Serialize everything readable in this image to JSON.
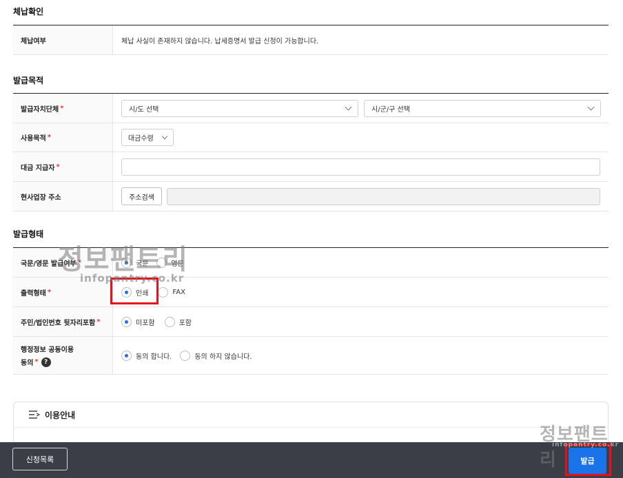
{
  "payment_check": {
    "title": "체납확인",
    "label": "체납여부",
    "value": "체납 사실이 존재하지 않습니다. 납세증명서 발급 신청이 가능합니다."
  },
  "purpose": {
    "title": "발급목적",
    "rows": {
      "authority": {
        "label": "발급자치단체",
        "sido_placeholder": "시/도 선택",
        "sigungu_placeholder": "시/군/구 선택"
      },
      "use": {
        "label": "사용목적",
        "value": "대금수령"
      },
      "payer": {
        "label": "대금 지급자"
      },
      "site_address": {
        "label": "현사업장 주소",
        "search_button": "주소검색"
      }
    }
  },
  "form": {
    "title": "발급형태",
    "language": {
      "label": "국문/영문 발급여부",
      "options": [
        "국문",
        "영문"
      ],
      "selected": 0
    },
    "output": {
      "label": "출력형태",
      "options": [
        "인쇄",
        "FAX"
      ],
      "selected": 0
    },
    "id_suffix": {
      "label": "주민/법인번호 뒷자리포함",
      "options": [
        "미포함",
        "포함"
      ],
      "selected": 0
    },
    "consent": {
      "label_line1": "행정정보 공동이용",
      "label_line2": "동의",
      "help": "?",
      "options": [
        "동의 합니다.",
        "동의 하지 않습니다."
      ],
      "selected": 0
    }
  },
  "guide": {
    "title": "이용안내"
  },
  "bottom": {
    "list_button": "신청목록",
    "issue_button": "발급"
  },
  "watermark": {
    "text": "정보팬트리",
    "url": "infopantry.co.kr"
  },
  "colors": {
    "accent": "#1a73e8",
    "required": "#e53935",
    "highlight": "#e8101b",
    "bar": "#3b3e46"
  }
}
